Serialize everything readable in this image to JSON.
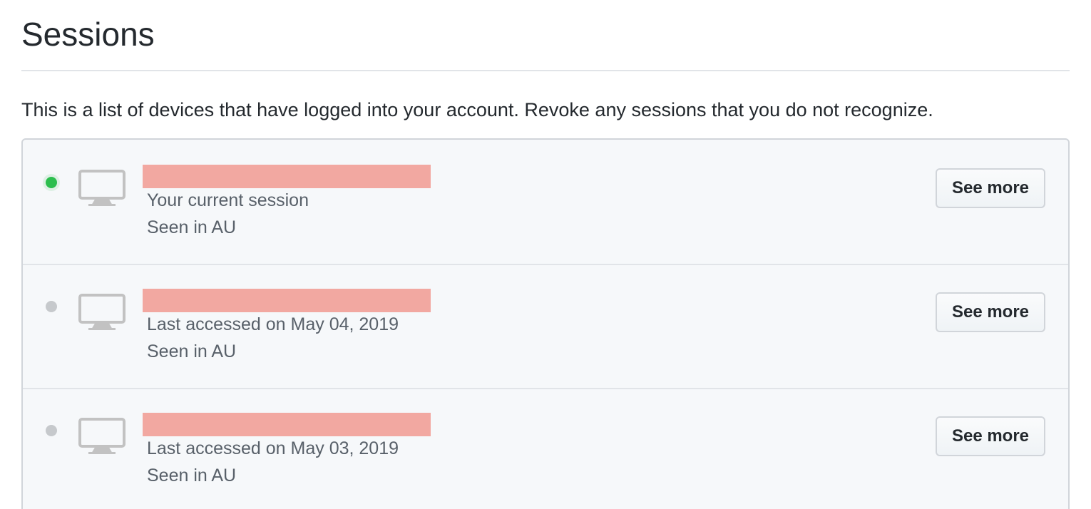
{
  "page": {
    "title": "Sessions",
    "intro": "This is a list of devices that have logged into your account. Revoke any sessions that you do not recognize."
  },
  "colors": {
    "active_dot": "#2cbe4e",
    "inactive_dot": "#c6c9cc",
    "redaction": "#f2a8a1",
    "list_background": "#f6f8fa"
  },
  "sessions": [
    {
      "status": "active",
      "device_icon": "desktop-icon",
      "device_name_redacted": true,
      "detail": "Your current session",
      "location": "Seen in AU",
      "button_label": "See more"
    },
    {
      "status": "inactive",
      "device_icon": "desktop-icon",
      "device_name_redacted": true,
      "detail": "Last accessed on May 04, 2019",
      "location": "Seen in AU",
      "button_label": "See more"
    },
    {
      "status": "inactive",
      "device_icon": "desktop-icon",
      "device_name_redacted": true,
      "detail": "Last accessed on May 03, 2019",
      "location": "Seen in AU",
      "button_label": "See more"
    }
  ]
}
